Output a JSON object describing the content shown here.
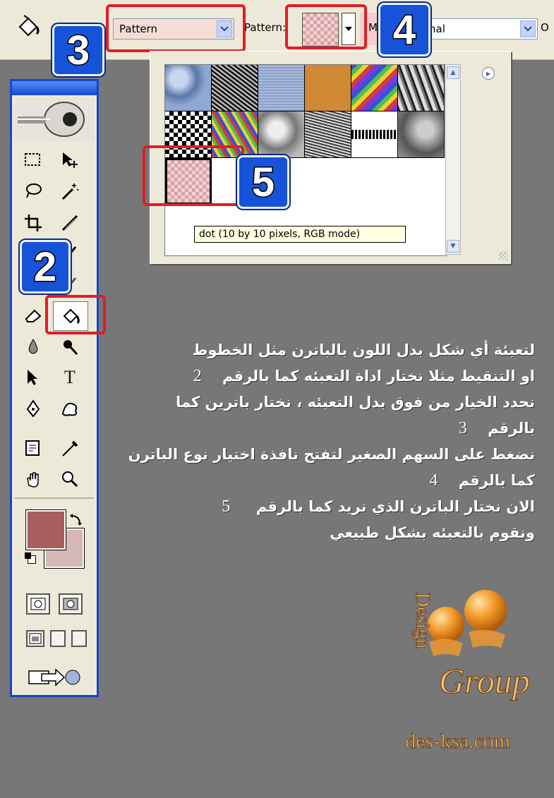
{
  "options_bar": {
    "fill_source": "Pattern",
    "pattern_label": "Pattern:",
    "mode_label": "M",
    "mode_value": "rmal",
    "right_edge_label": "O"
  },
  "callouts": [
    "2",
    "3",
    "4",
    "5"
  ],
  "pattern_picker": {
    "tooltip": "dot (10 by 10 pixels, RGB mode)"
  },
  "colors": {
    "foreground": "#a65e5e",
    "background": "#d5b7b6",
    "highlight": "#e21d22",
    "badge": "#1653d8"
  },
  "instructions": [
    {
      "text": "لتعبئة أي شكل بدل اللون بالباترن مثل الخطوط",
      "num": ""
    },
    {
      "text": "او التنقيط مثلا نختار اداة التعبئه كما بالرقم",
      "num": "2"
    },
    {
      "text": "نحدد الخيار من فوق بدل التعبئه ، نختار باترين كما",
      "num": ""
    },
    {
      "text": "بالرقم",
      "num": "3"
    },
    {
      "text": "نضغط على السهم الصغير لتفتح نافذة اختيار نوع الباترن",
      "num": ""
    },
    {
      "text": "كما بالرقم",
      "num": "4"
    },
    {
      "text": "الان نختار الباترن الذي نريد كما بالرقم",
      "num": "5"
    },
    {
      "text": "ونقوم بالتعبئه بشكل طبيعي",
      "num": ""
    }
  ],
  "logo": {
    "design": "Design",
    "group": "Group",
    "site": "des-ksa.com"
  }
}
